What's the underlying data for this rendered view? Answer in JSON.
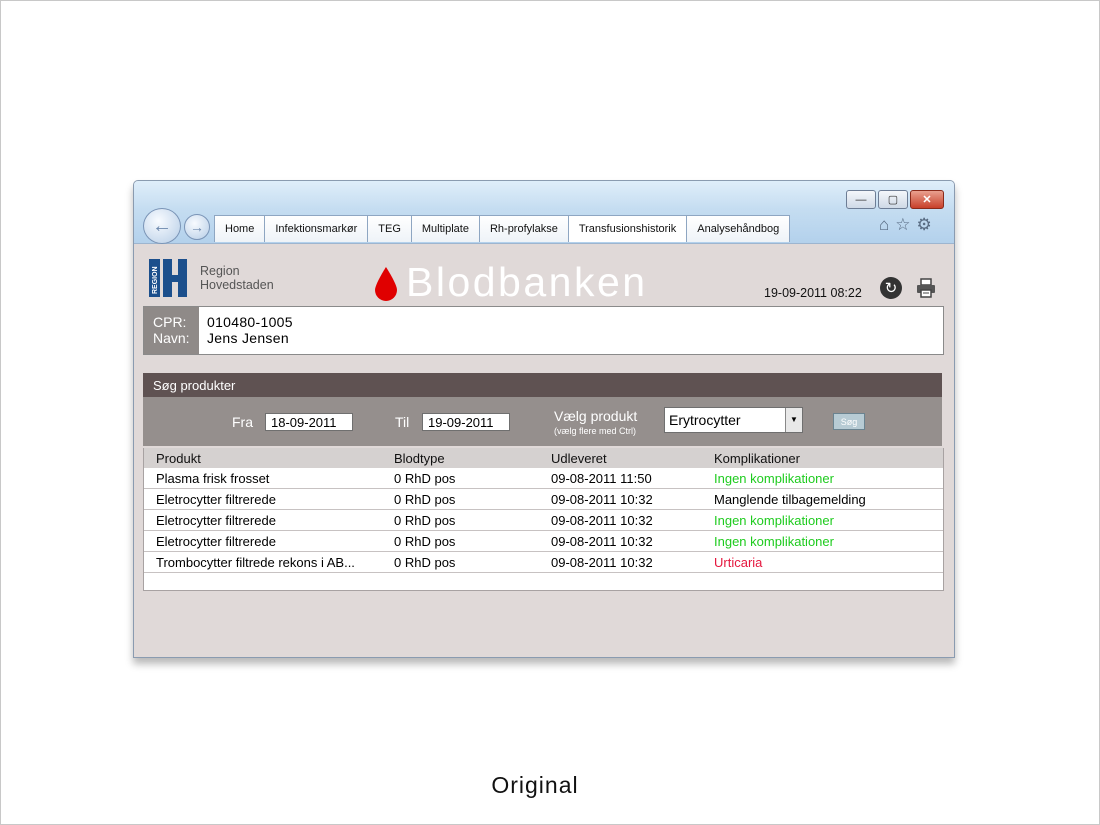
{
  "caption": "Original",
  "browser": {
    "tabs": [
      "Home",
      "Infektionsmarkør",
      "TEG",
      "Multiplate",
      "Rh-profylakse",
      "Transfusionshistorik",
      "Analysehåndbog"
    ],
    "active_tab": "Transfusionshistorik"
  },
  "header": {
    "logo_line1": "Region",
    "logo_line2": "Hovedstaden",
    "logo_vertical": "REGION",
    "title": "Blodbanken",
    "datetime": "19-09-2011 08:22"
  },
  "patient": {
    "cpr_label": "CPR:",
    "name_label": "Navn:",
    "cpr": "010480-1005",
    "name": "Jens Jensen"
  },
  "search": {
    "title": "Søg produkter",
    "from_label": "Fra",
    "from_value": "18-09-2011",
    "to_label": "Til",
    "to_value": "19-09-2011",
    "product_label": "Vælg produkt",
    "product_hint": "(vælg flere med Ctrl)",
    "product_value": "Erytrocytter",
    "search_button": "Søg"
  },
  "table": {
    "columns": [
      "Produkt",
      "Blodtype",
      "Udleveret",
      "Komplikationer"
    ],
    "rows": [
      {
        "product": "Plasma frisk frosset",
        "bloodtype": "0 RhD pos",
        "delivered": "09-08-2011 11:50",
        "complications": "Ingen komplikationer",
        "status": "ok"
      },
      {
        "product": "Eletrocytter filtrerede",
        "bloodtype": "0 RhD pos",
        "delivered": "09-08-2011 10:32",
        "complications": "Manglende tilbagemelding",
        "status": "neutral"
      },
      {
        "product": "Eletrocytter filtrerede",
        "bloodtype": "0 RhD pos",
        "delivered": "09-08-2011 10:32",
        "complications": "Ingen komplikationer",
        "status": "ok"
      },
      {
        "product": "Eletrocytter filtrerede",
        "bloodtype": "0 RhD pos",
        "delivered": "09-08-2011 10:32",
        "complications": "Ingen komplikationer",
        "status": "ok"
      },
      {
        "product": "Trombocytter filtrede rekons i AB...",
        "bloodtype": "0 RhD pos",
        "delivered": "09-08-2011 10:32",
        "complications": "Urticaria",
        "status": "bad"
      }
    ]
  },
  "colors": {
    "ok": "#1ecb1e",
    "bad": "#e5173e",
    "header_bar": "#5f5252",
    "search_bar": "#958f8d",
    "page_bg": "#e0d9d8",
    "logo_blue": "#1c4f8c",
    "drop_red": "#e00000"
  },
  "icons": [
    "back-arrow-icon",
    "forward-arrow-icon",
    "home-icon",
    "star-icon",
    "gear-icon",
    "refresh-icon",
    "print-icon",
    "blood-drop-icon"
  ]
}
